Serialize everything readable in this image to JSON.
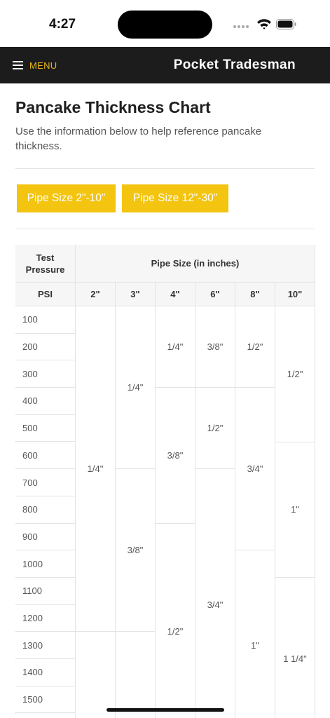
{
  "status_bar": {
    "time": "4:27"
  },
  "header": {
    "menu_label": "MENU",
    "brand": "Pocket Tradesman"
  },
  "page": {
    "title": "Pancake Thickness Chart",
    "intro": "Use the information below to help reference pancake thickness."
  },
  "tabs": [
    {
      "label": "Pipe Size 2\"-10\"",
      "active": true
    },
    {
      "label": "Pipe Size 12\"-30\"",
      "active": false
    }
  ],
  "chart_data": {
    "type": "table",
    "header": {
      "test_pressure": "Test Pressure",
      "pipe_size": "Pipe Size (in inches)",
      "psi": "PSI"
    },
    "pipe_sizes": [
      "2\"",
      "3\"",
      "4\"",
      "6\"",
      "8\"",
      "10\""
    ],
    "psi_values": [
      "100",
      "200",
      "300",
      "400",
      "500",
      "600",
      "700",
      "800",
      "900",
      "1000",
      "1100",
      "1200",
      "1300",
      "1400",
      "1500"
    ],
    "thickness_spans": [
      [
        {
          "value": "1/4\"",
          "start": 0,
          "end": 11
        },
        {
          "value": "",
          "start": 12,
          "end": 15
        }
      ],
      [
        {
          "value": "1/4\"",
          "start": 0,
          "end": 5
        },
        {
          "value": "3/8\"",
          "start": 6,
          "end": 11
        },
        {
          "value": "",
          "start": 12,
          "end": 15
        }
      ],
      [
        {
          "value": "1/4\"",
          "start": 0,
          "end": 2
        },
        {
          "value": "3/8\"",
          "start": 3,
          "end": 7
        },
        {
          "value": "1/2\"",
          "start": 8,
          "end": 15
        }
      ],
      [
        {
          "value": "3/8\"",
          "start": 0,
          "end": 2
        },
        {
          "value": "1/2\"",
          "start": 3,
          "end": 5
        },
        {
          "value": "3/4\"",
          "start": 6,
          "end": 15
        }
      ],
      [
        {
          "value": "1/2\"",
          "start": 0,
          "end": 2
        },
        {
          "value": "3/4\"",
          "start": 3,
          "end": 8
        },
        {
          "value": "1\"",
          "start": 9,
          "end": 15
        }
      ],
      [
        {
          "value": "1/2\"",
          "start": 0,
          "end": 4
        },
        {
          "value": "1\"",
          "start": 5,
          "end": 9
        },
        {
          "value": "1 1/4\"",
          "start": 10,
          "end": 15
        }
      ]
    ]
  }
}
